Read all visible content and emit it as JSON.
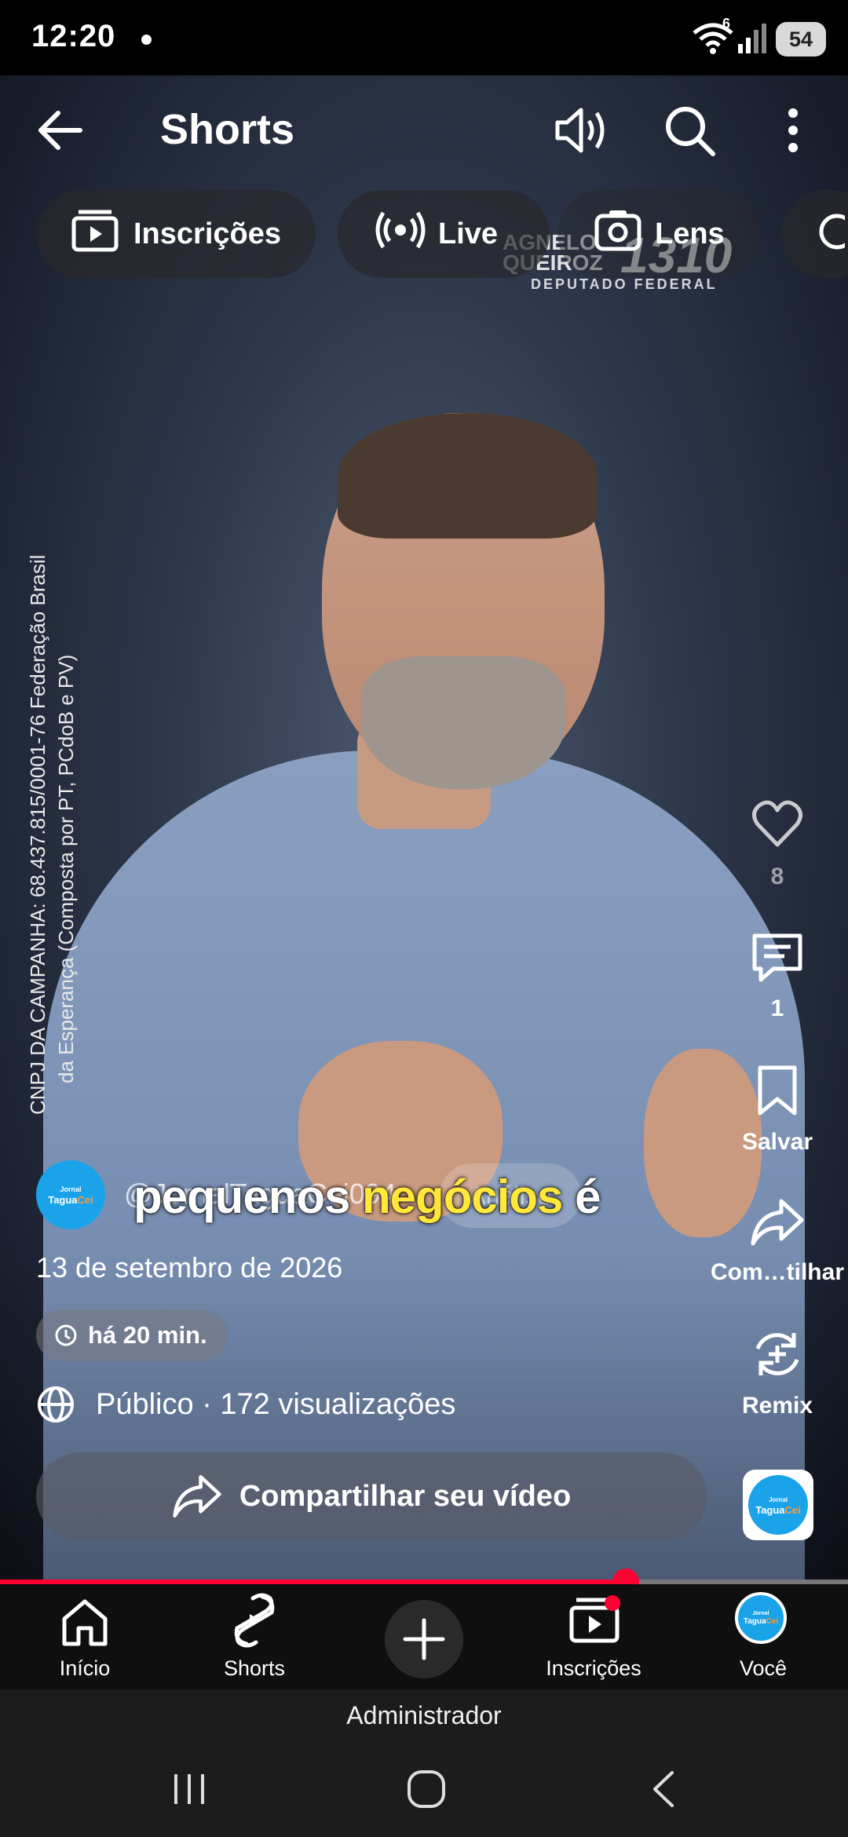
{
  "status_bar": {
    "time": "12:20",
    "battery": "54",
    "wifi_band": "6"
  },
  "header": {
    "title": "Shorts"
  },
  "chips": [
    {
      "label": "Inscrições",
      "icon": "subscriptions-icon"
    },
    {
      "label": "Live",
      "icon": "live-broadcast-icon"
    },
    {
      "label": "Lens",
      "icon": "lens-icon"
    }
  ],
  "watermark": {
    "name_line1": "AGNELO",
    "name_line2": "QUEIROZ",
    "number": "1310",
    "subtitle": "DEPUTADO FEDERAL"
  },
  "legal_text": {
    "line1": "CNPJ DA CAMPANHA: 68.437.815/0001-76 Federação Brasil",
    "line2": "da Esperança (Composta por PT, PCdoB e PV)"
  },
  "caption": {
    "part1": "pequenos ",
    "highlight": "negócios",
    "part2": " é"
  },
  "actions": {
    "like_count": "8",
    "comment_count": "1",
    "save_label": "Salvar",
    "share_label": "Com…tilhar",
    "remix_label": "Remix"
  },
  "channel": {
    "handle": "@JornalTaguaCei094",
    "analyse_label": "Análise",
    "avatar_line1": "Jornal",
    "avatar_line2": "Tagua",
    "avatar_line2b": "Cei"
  },
  "meta": {
    "date": "13 de setembro de 2026",
    "time_ago": "há 20 min.",
    "visibility": "Público · 172 visualizações"
  },
  "share_button": {
    "label": "Compartilhar seu vídeo"
  },
  "progress": {
    "fraction": 0.738
  },
  "bottom_nav": [
    {
      "label": "Início",
      "icon": "home-icon"
    },
    {
      "label": "Shorts",
      "icon": "shorts-icon"
    },
    {
      "label": "",
      "icon": "create-plus-icon"
    },
    {
      "label": "Inscrições",
      "icon": "subscriptions-icon"
    },
    {
      "label": "Você",
      "icon": "profile-avatar"
    }
  ],
  "admin_bar": {
    "label": "Administrador"
  },
  "colors": {
    "accent": "#ff0033",
    "caption_highlight": "#ffe83a",
    "avatar_blue": "#1aa3e8"
  }
}
